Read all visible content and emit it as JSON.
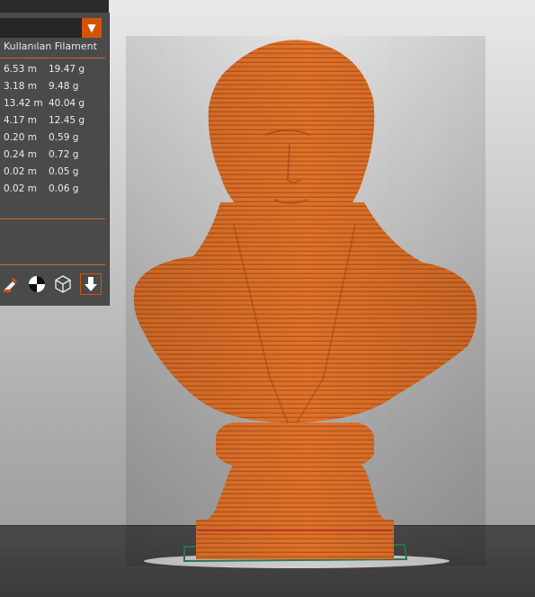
{
  "panel": {
    "filament_header": "Kullanılan Filament",
    "rows": [
      {
        "length": "6.53 m",
        "weight": "19.47 g"
      },
      {
        "length": "3.18 m",
        "weight": "9.48 g"
      },
      {
        "length": "13.42 m",
        "weight": "40.04 g"
      },
      {
        "length": "4.17 m",
        "weight": "12.45 g"
      },
      {
        "length": "0.20 m",
        "weight": "0.59 g"
      },
      {
        "length": "0.24 m",
        "weight": "0.72 g"
      },
      {
        "length": "0.02 m",
        "weight": "0.05 g"
      },
      {
        "length": "0.02 m",
        "weight": "0.06 g"
      }
    ],
    "toolbar_icons": [
      "paint-brush-icon",
      "center-target-icon",
      "cube-icon",
      "export-arrow-icon"
    ]
  },
  "colors": {
    "accent": "#d35400",
    "model": "#e0722a",
    "panel_bg": "#4a4a4a",
    "floor": "#3b3b3b"
  }
}
